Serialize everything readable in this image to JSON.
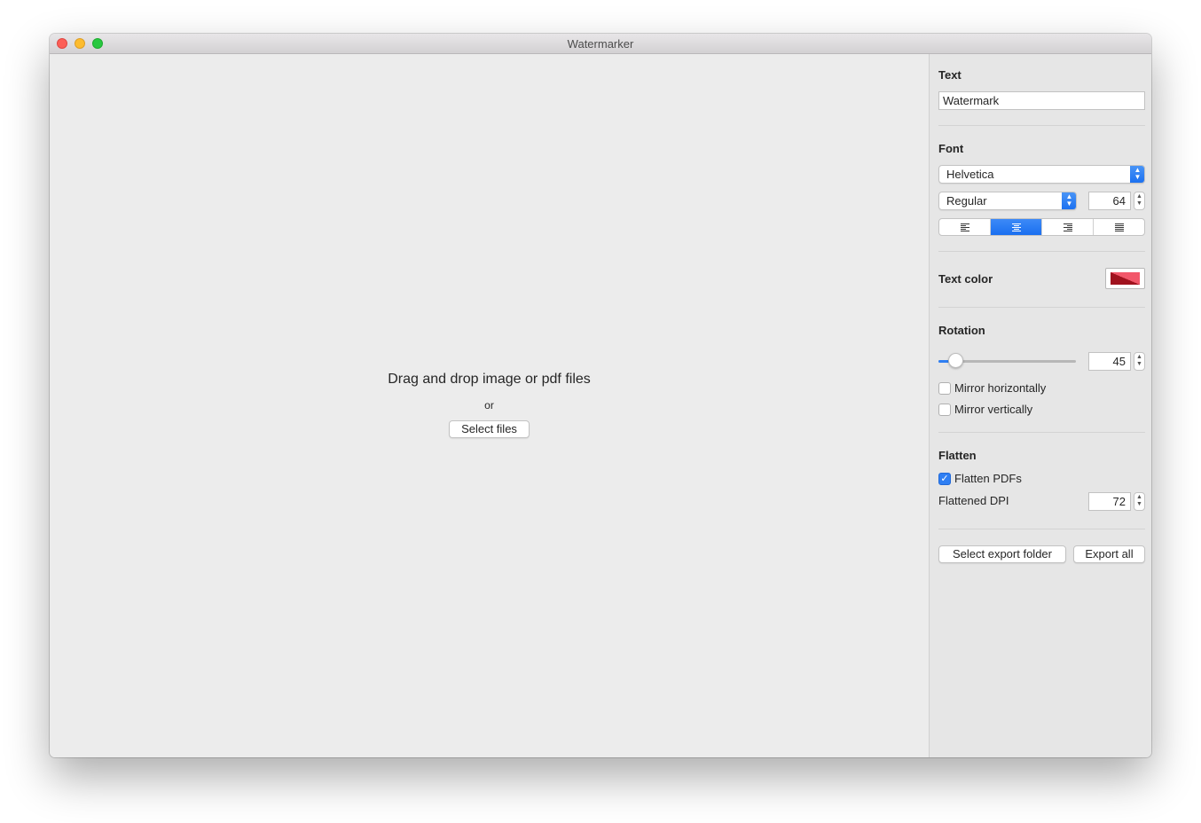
{
  "window": {
    "title": "Watermarker"
  },
  "dropzone": {
    "title": "Drag and drop image or pdf files",
    "or": "or",
    "select_files": "Select files"
  },
  "sidebar": {
    "text_section": {
      "label": "Text",
      "value": "Watermark"
    },
    "font_section": {
      "label": "Font",
      "family": "Helvetica",
      "style": "Regular",
      "size": "64",
      "alignment_options": [
        "left",
        "center",
        "right",
        "justify"
      ],
      "alignment_selected": "center"
    },
    "text_color": {
      "label": "Text color",
      "color": "#c8102e"
    },
    "rotation": {
      "label": "Rotation",
      "value": "45",
      "slider_fraction": 0.125,
      "mirror_horizontally": {
        "label": "Mirror horizontally",
        "checked": false
      },
      "mirror_vertically": {
        "label": "Mirror vertically",
        "checked": false
      }
    },
    "flatten": {
      "label": "Flatten",
      "flatten_pdfs": {
        "label": "Flatten PDFs",
        "checked": true
      },
      "dpi_label": "Flattened DPI",
      "dpi_value": "72"
    },
    "actions": {
      "select_export_folder": "Select export folder",
      "export_all": "Export all"
    }
  },
  "colors": {
    "accent": "#2f7ff3"
  }
}
